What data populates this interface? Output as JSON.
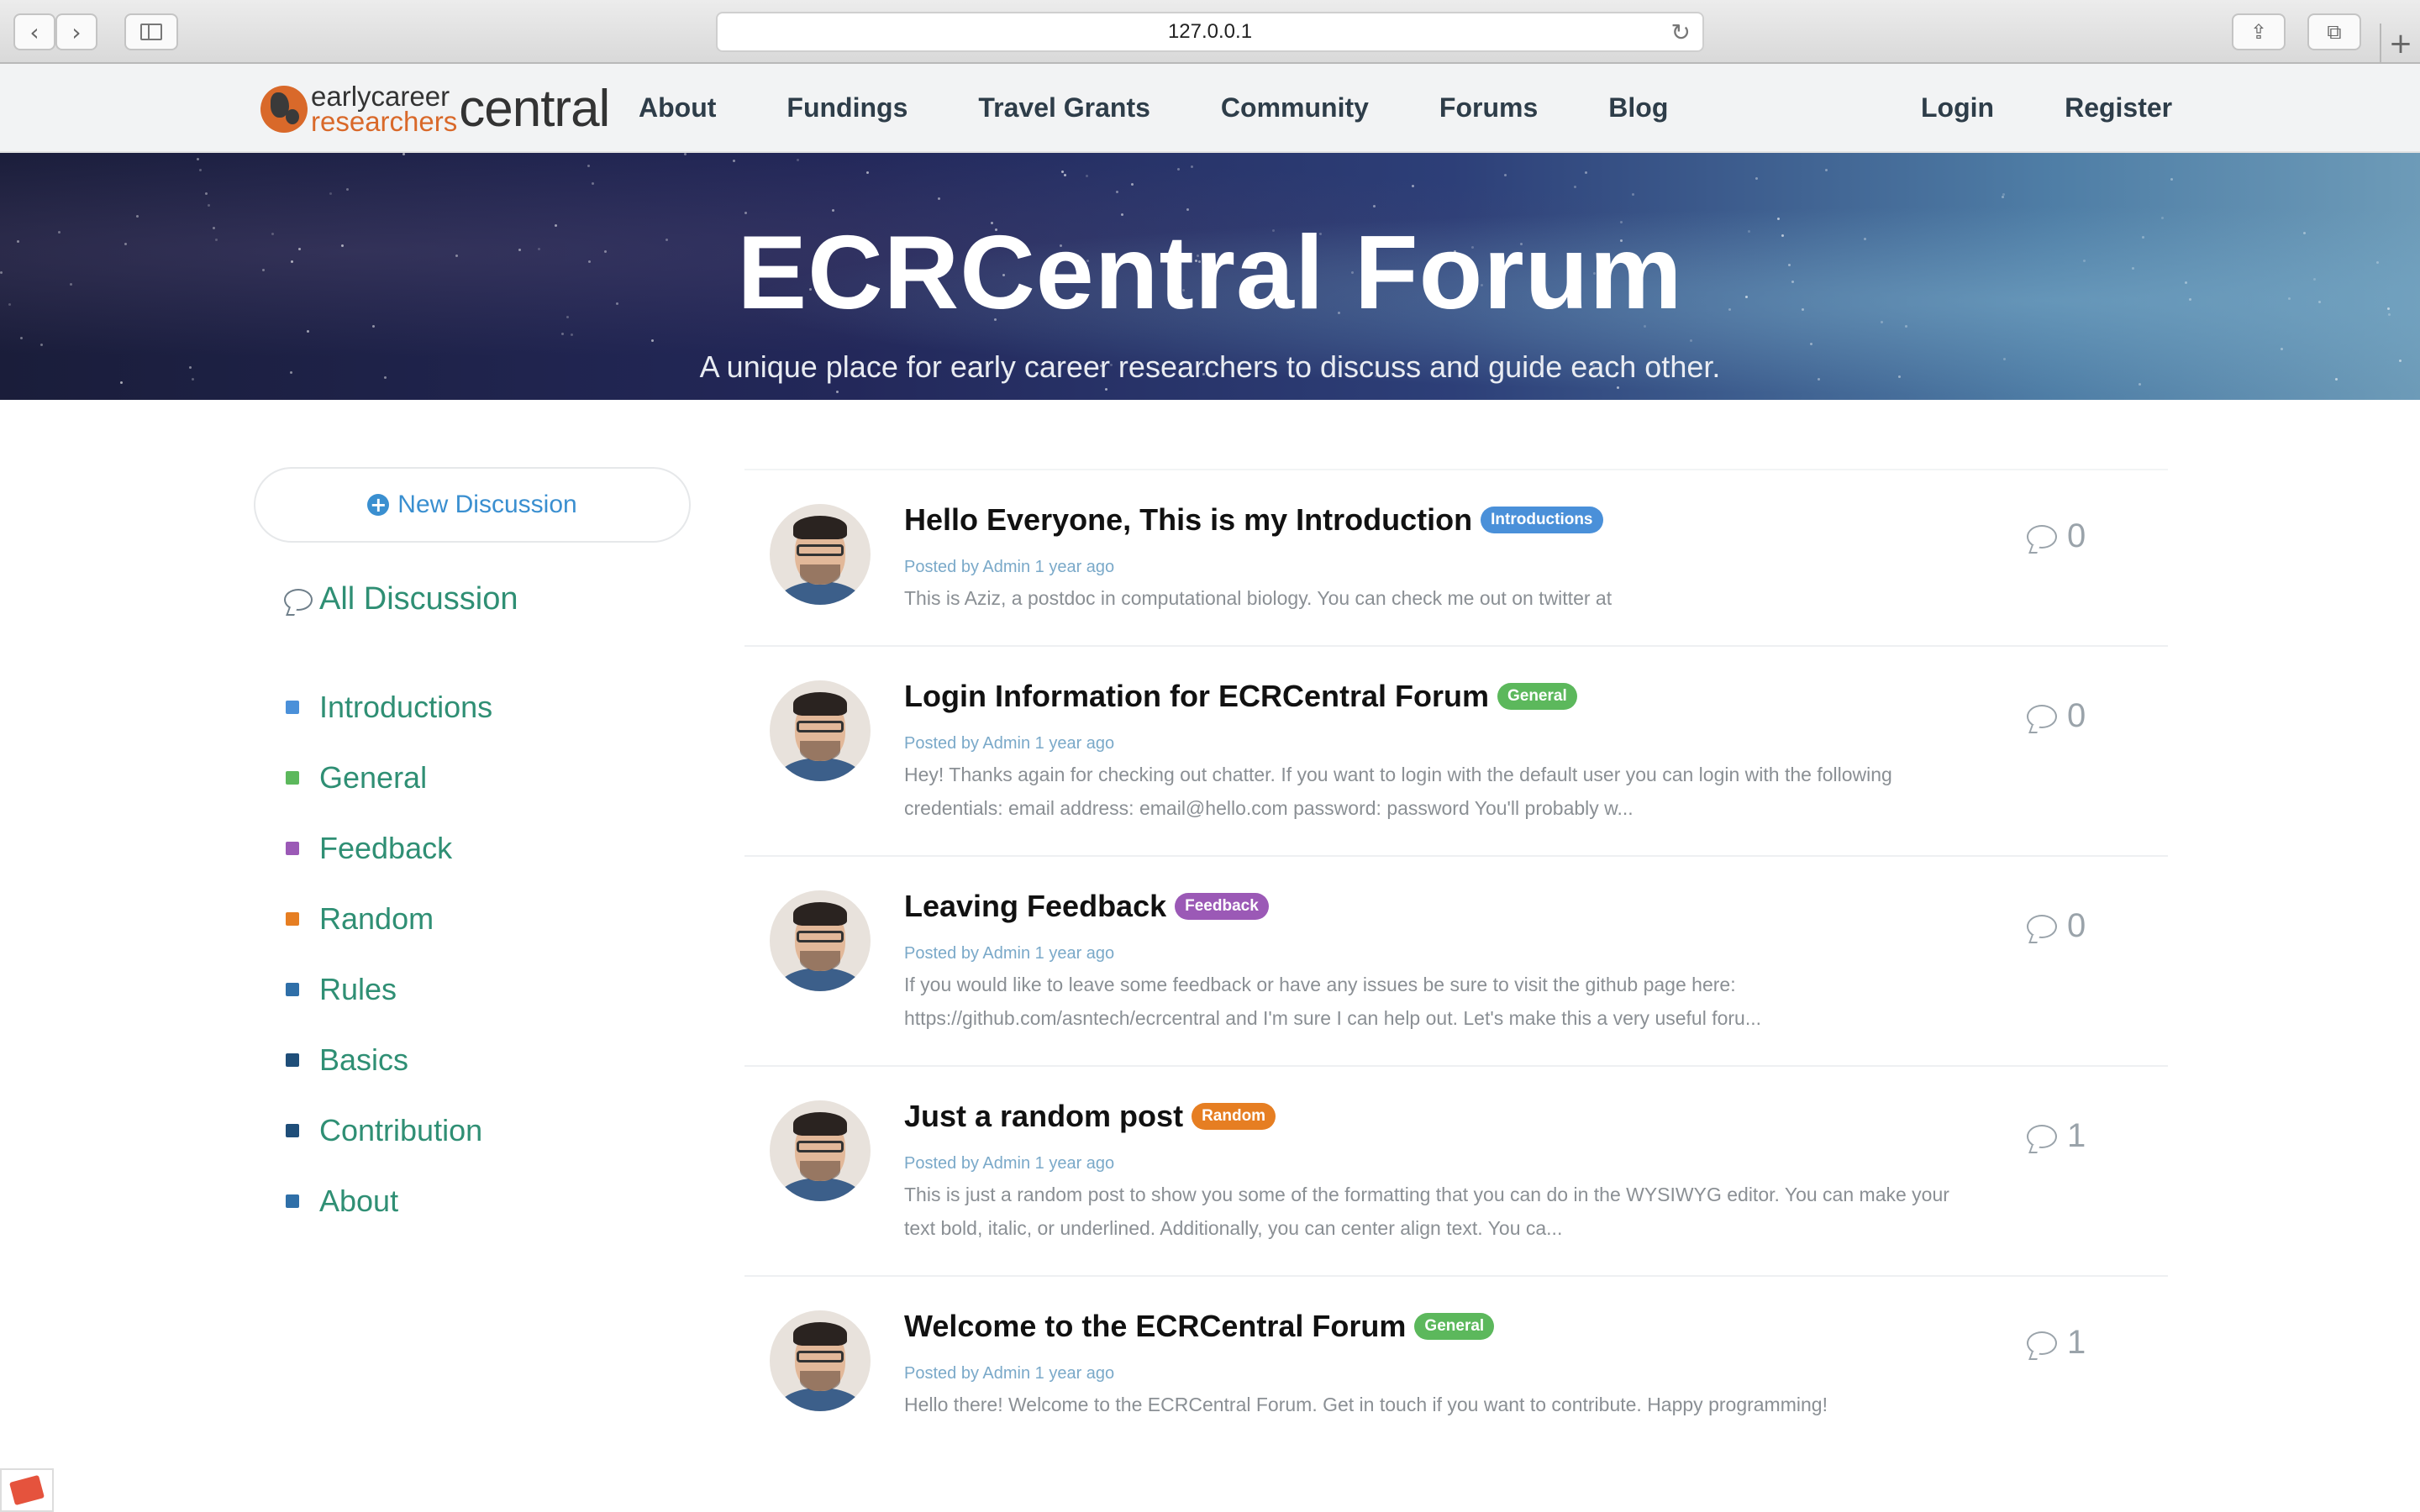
{
  "browser": {
    "url": "127.0.0.1",
    "back_icon": "chevron-left-icon",
    "forward_icon": "chevron-right-icon"
  },
  "nav": {
    "logo": {
      "line1": "earlycareer",
      "line2": "researchers",
      "big": "central"
    },
    "links": [
      "About",
      "Fundings",
      "Travel Grants",
      "Community",
      "Forums",
      "Blog"
    ],
    "auth": [
      "Login",
      "Register"
    ]
  },
  "hero": {
    "title": "ECRCentral Forum",
    "subtitle": "A unique place for early career researchers to discuss and guide each other."
  },
  "sidebar": {
    "new_discussion": "New Discussion",
    "all_discussion": "All Discussion",
    "channels": [
      {
        "label": "Introductions",
        "color": "#4a90d9"
      },
      {
        "label": "General",
        "color": "#5cb85c"
      },
      {
        "label": "Feedback",
        "color": "#9b59b6"
      },
      {
        "label": "Random",
        "color": "#e67e22"
      },
      {
        "label": "Rules",
        "color": "#2f6fa8"
      },
      {
        "label": "Basics",
        "color": "#1f4e79"
      },
      {
        "label": "Contribution",
        "color": "#1f4e79"
      },
      {
        "label": "About",
        "color": "#2f6fa8"
      }
    ]
  },
  "threads": [
    {
      "title": "Hello Everyone, This is my Introduction",
      "badge": "Introductions",
      "badge_color": "#4a90d9",
      "meta": "Posted by Admin 1 year ago",
      "excerpt": "This is Aziz, a postdoc in computational biology. You can check me out on twitter at",
      "count": "0"
    },
    {
      "title": "Login Information for ECRCentral Forum",
      "badge": "General",
      "badge_color": "#5cb85c",
      "meta": "Posted by Admin 1 year ago",
      "excerpt": "Hey! Thanks again for checking out chatter. If you want to login with the default user you can login with the following credentials: email address: email@hello.com password: password You'll probably w...",
      "count": "0"
    },
    {
      "title": "Leaving Feedback",
      "badge": "Feedback",
      "badge_color": "#9b59b6",
      "meta": "Posted by Admin 1 year ago",
      "excerpt": "If you would like to leave some feedback or have any issues be sure to visit the github page here: https://github.com/asntech/ecrcentral and I'm sure I can help out. Let's make this a very useful foru...",
      "count": "0"
    },
    {
      "title": "Just a random post",
      "badge": "Random",
      "badge_color": "#e67e22",
      "meta": "Posted by Admin 1 year ago",
      "excerpt": "This is just a random post to show you some of the formatting that you can do in the WYSIWYG editor. You can make your text bold, italic, or underlined. Additionally, you can center align text. You ca...",
      "count": "1"
    },
    {
      "title": "Welcome to the ECRCentral Forum",
      "badge": "General",
      "badge_color": "#5cb85c",
      "meta": "Posted by Admin 1 year ago",
      "excerpt": "Hello there! Welcome to the ECRCentral Forum. Get in touch if you want to contribute. Happy programming!",
      "count": "1"
    }
  ]
}
